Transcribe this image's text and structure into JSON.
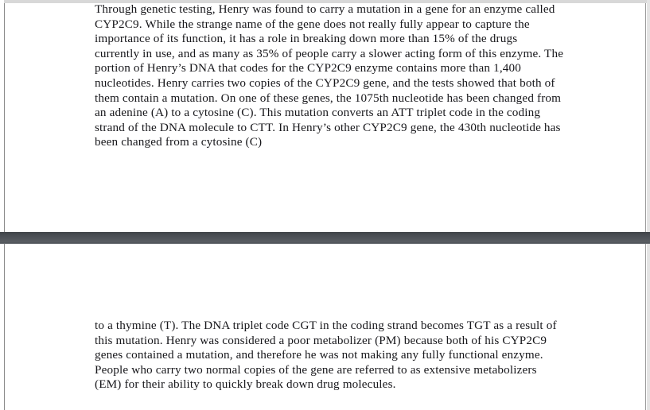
{
  "viewer": {
    "background_color": "#ffffff",
    "separator_color": "#4e5257",
    "text_color": "#17171b"
  },
  "document": {
    "pages": [
      {
        "page_label": "page-1",
        "body": "Through genetic testing, Henry was found to carry a mutation in a gene for an enzyme called CYP2C9. While the strange name of the gene does not really fully appear to capture the importance of its function, it has a role in breaking down more than 15% of the drugs currently in use, and as many as 35% of people carry a slower acting form of this enzyme. The portion of Henry’s DNA that codes for the CYP2C9 enzyme contains more than 1,400 nucleotides. Henry carries two copies of the CYP2C9 gene, and the tests showed that both of them contain a mutation. On one of these genes, the 1075th nucleotide has been changed from an adenine (A) to a cytosine (C). This mutation converts an ATT triplet code in the coding strand of the DNA molecule to CTT. In Henry’s other CYP2C9 gene, the 430th nucleotide has been changed from a cytosine (C)"
      },
      {
        "page_label": "page-2",
        "body": "to a thymine (T). The DNA triplet code CGT in the coding strand becomes TGT as a result of this mutation. Henry was considered a poor metabolizer (PM) because both of his CYP2C9 genes contained a mutation, and therefore he was not making any fully functional enzyme. People who carry two normal copies of the gene are referred to as extensive metabolizers (EM) for their ability to quickly break down drug molecules."
      }
    ]
  }
}
